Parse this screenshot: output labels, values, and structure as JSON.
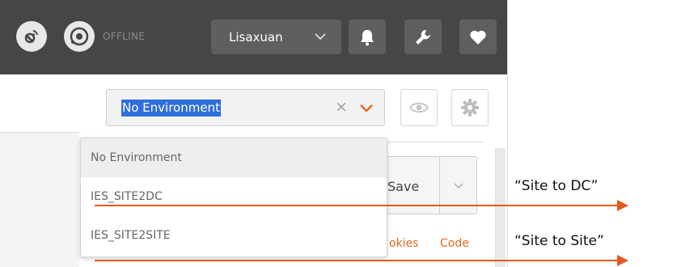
{
  "header": {
    "status_label": "OFFLINE",
    "user_name": "Lisaxuan",
    "icons": [
      "satellite-icon",
      "sync-icon",
      "bell-icon",
      "wrench-icon",
      "heart-icon"
    ]
  },
  "environment": {
    "selected": "No Environment",
    "clear_symbol": "×",
    "options": [
      {
        "label": "No Environment",
        "highlighted": true
      },
      {
        "label": "IES_SITE2DC",
        "highlighted": false
      },
      {
        "label": "IES_SITE2SITE",
        "highlighted": false
      }
    ]
  },
  "request": {
    "save_label": "Save",
    "cookies_label": "okies",
    "code_label": "Code"
  },
  "annotations": [
    {
      "label": "“Site to DC”"
    },
    {
      "label": "“Site to Site”"
    }
  ],
  "colors": {
    "header_bg": "#464646",
    "accent": "#e8661b",
    "arrow": "#e05a1e",
    "selection": "#2f6fdc"
  }
}
